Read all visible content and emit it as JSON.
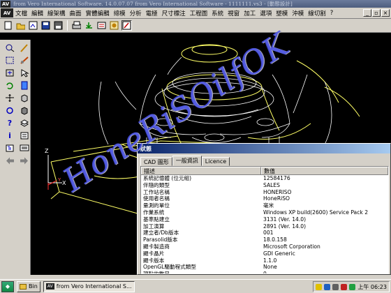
{
  "window": {
    "title": "from Vero International Software. 14.0.07.07 from Vero International Software - 1111111.vs3 - [動態設計]",
    "app_icon_label": "AV"
  },
  "menubar": {
    "items": [
      "文檔",
      "編輯",
      "線架構",
      "曲面",
      "實體編輯",
      "總模",
      "分析",
      "電極",
      "尺寸標注",
      "工程圖",
      "系統",
      "視窗",
      "加工",
      "選項",
      "塑模",
      "沖模",
      "線切割",
      "?"
    ]
  },
  "toolbar": {
    "buttons": [
      "new-file",
      "open-folder",
      "open-drawing",
      "save",
      "save-as",
      "print",
      "export",
      "import",
      "render",
      "active-mode"
    ]
  },
  "dialog": {
    "title": "狀態",
    "tabs": [
      "CAD 圖形",
      "一般資訊",
      "Licence"
    ],
    "selected_tab": "一般資訊",
    "columns": [
      "描述",
      "數值"
    ],
    "rows": [
      [
        "系統記憶體 (位元組)",
        "12584176"
      ],
      [
        "伴隨的類型",
        "SALES"
      ],
      [
        "工作站名稱",
        "HONERISO"
      ],
      [
        "使用者名稱",
        "HoneRiSO"
      ],
      [
        "量測的單位",
        "毫米"
      ],
      [
        "作業系統",
        "Windows XP build(2600) Service Pack 2"
      ],
      [
        "基準點建立",
        "3131 (Ver. 14.0)"
      ],
      [
        "加工演算",
        "2891 (Ver. 14.0)"
      ],
      [
        "建立者/Db版本",
        "001"
      ],
      [
        "Parasolid版本",
        "18.0.158"
      ],
      [
        "顯卡製造商",
        "Microsoft Corporation"
      ],
      [
        "顯卡晶片",
        "GDI Generic"
      ],
      [
        "顯卡版本",
        "1.1.0"
      ],
      [
        "OpenGL驅動程式類型",
        "None"
      ],
      [
        "頂點的數目",
        "0"
      ]
    ]
  },
  "taskbar": {
    "tasks": [
      {
        "label": "Bin",
        "pressed": false
      },
      {
        "label": "from Vero International S...",
        "pressed": true
      }
    ],
    "clock": "上午 06:23"
  },
  "colors": {
    "wire": "#ffff66",
    "wire_white": "#ffffff",
    "watermark": "#4650e6",
    "titlebar": "#4d5d7e",
    "dialog_title": "#0a246a"
  }
}
